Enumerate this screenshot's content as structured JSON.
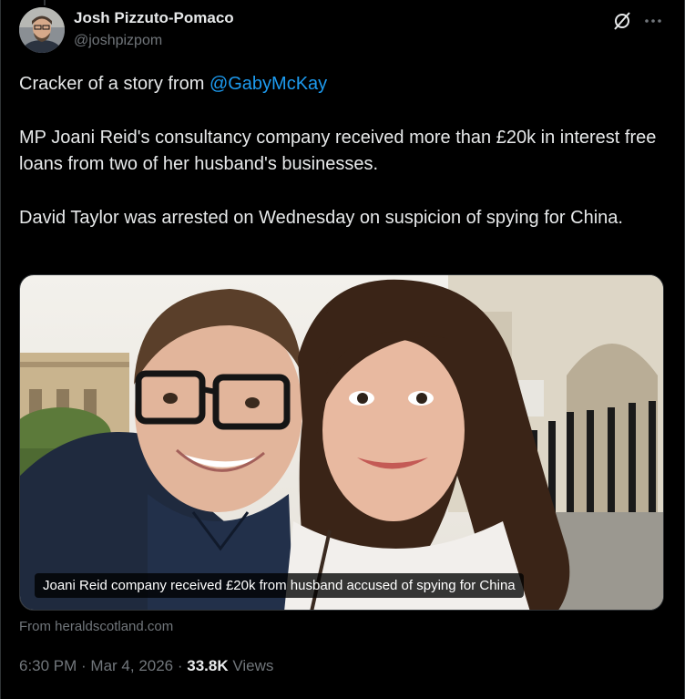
{
  "author": {
    "display_name": "Josh Pizzuto-Pomaco",
    "handle": "@joshpizpom",
    "avatar_icon": "profile-photo"
  },
  "header_icons": [
    "grok-icon",
    "more-icon"
  ],
  "tweet": {
    "line1_prefix": "Cracker of a story from ",
    "mention": "@GabyMcKay",
    "paragraph2": "MP Joani Reid's consultancy company received more than £20k in interest free loans from two of her husband's businesses.",
    "paragraph3": "David Taylor was arrested on Wednesday on suspicion of spying for China."
  },
  "card": {
    "caption": "Joani Reid company received £20k from husband accused of spying for China",
    "source": "From heraldscotland.com"
  },
  "meta": {
    "time": "6:30 PM",
    "sep1": " · ",
    "date": "Mar 4, 2026",
    "sep2": " · ",
    "views_count": "33.8K",
    "views_label": " Views"
  },
  "colors": {
    "background": "#000000",
    "text": "#e7e9ea",
    "secondary": "#71767b",
    "link": "#1d9bf0"
  }
}
